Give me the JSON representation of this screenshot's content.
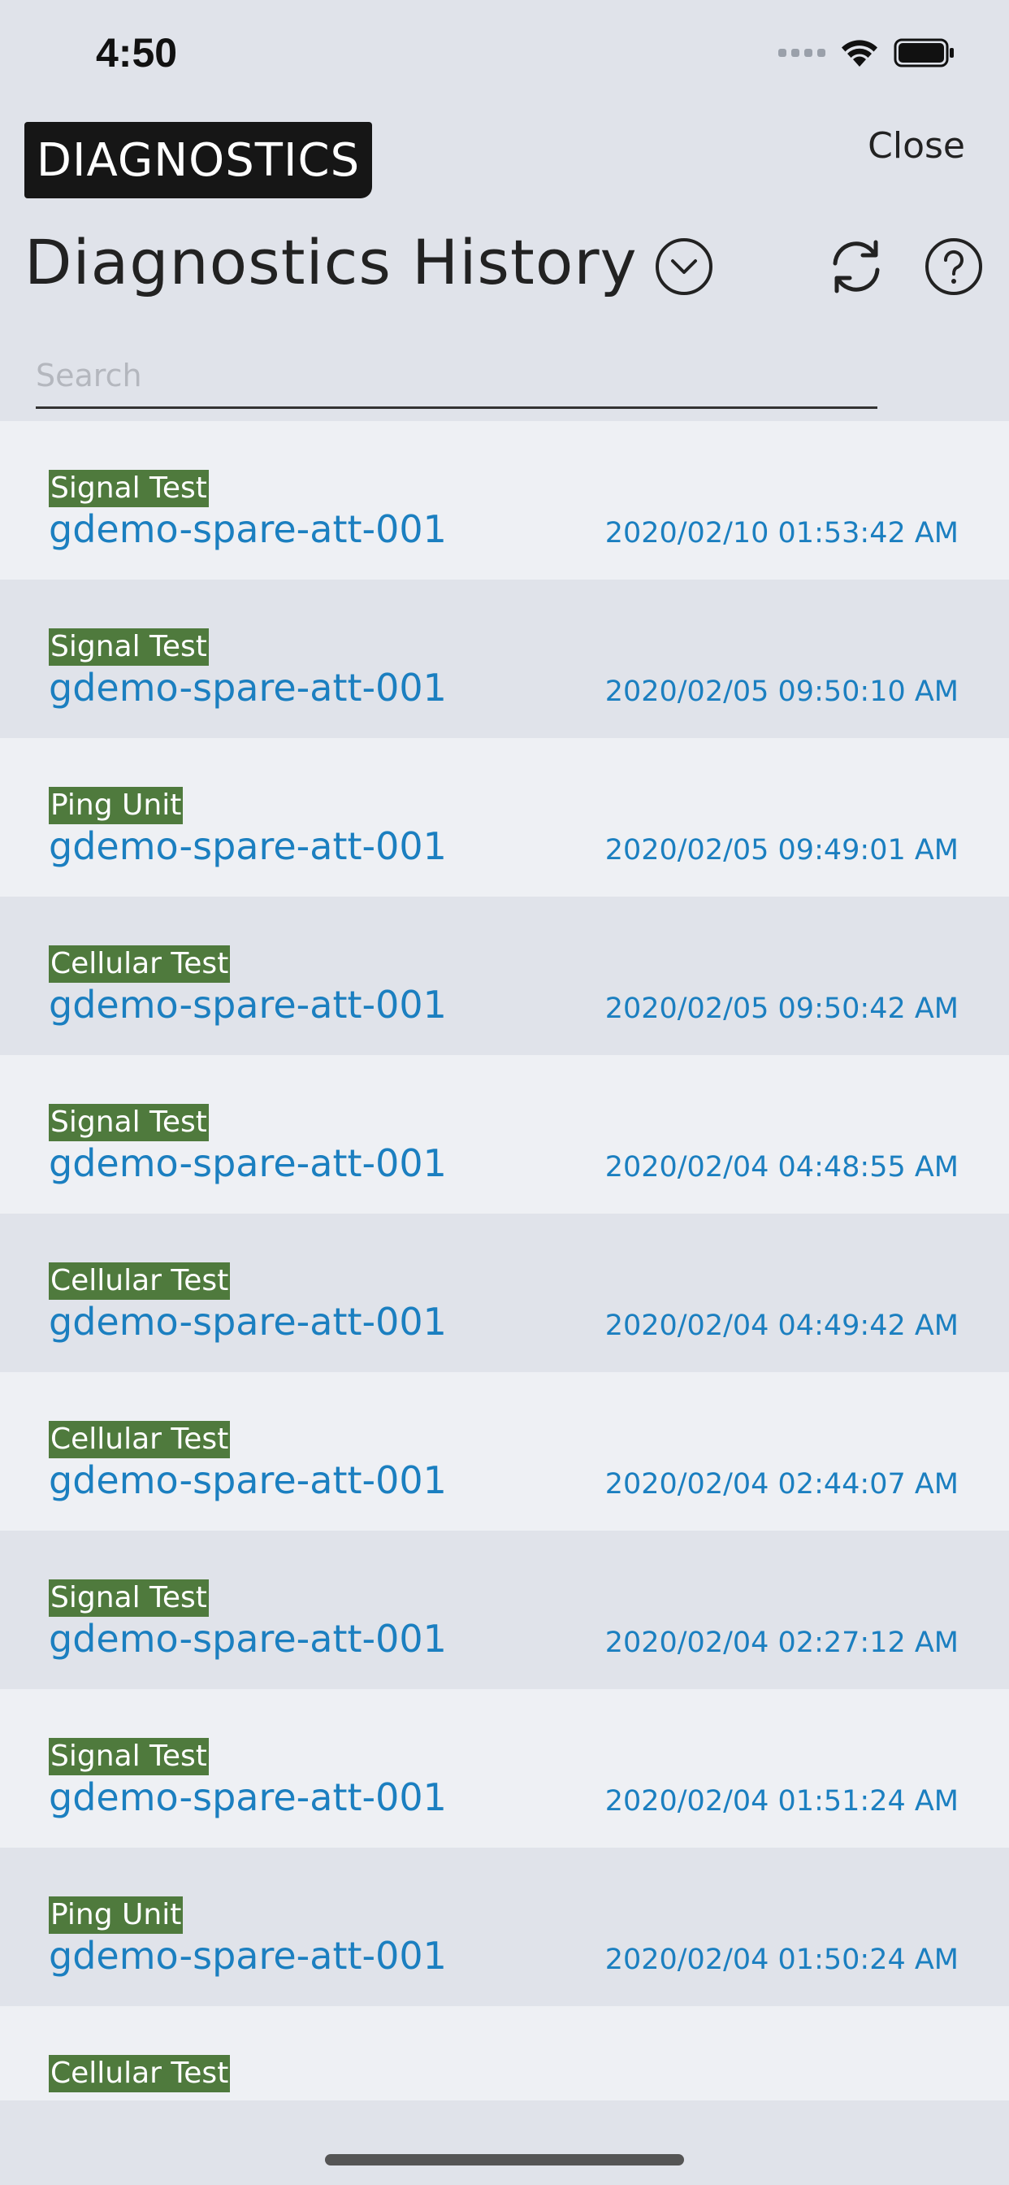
{
  "status_bar": {
    "time": "4:50",
    "icons": [
      "cellular-signal-icon",
      "wifi-icon",
      "battery-icon"
    ]
  },
  "header": {
    "brand": "DIAGNOSTICS",
    "close_label": "Close",
    "title": "Diagnostics History",
    "dropdown_icon": "chevron-down-circle-icon",
    "refresh_icon": "refresh-icon",
    "help_icon": "help-circle-icon"
  },
  "search": {
    "placeholder": "Search",
    "value": ""
  },
  "colors": {
    "tag_bg": "#4f7a3d",
    "link_text": "#1b7fc0",
    "row_light": "#eef0f4",
    "row_dark": "#e0e3ea"
  },
  "history": [
    {
      "type": "Signal Test",
      "device": "gdemo-spare-att-001",
      "timestamp": "2020/02/10 01:53:42 AM"
    },
    {
      "type": "Signal Test",
      "device": "gdemo-spare-att-001",
      "timestamp": "2020/02/05 09:50:10 AM"
    },
    {
      "type": "Ping Unit",
      "device": "gdemo-spare-att-001",
      "timestamp": "2020/02/05 09:49:01 AM"
    },
    {
      "type": "Cellular Test",
      "device": "gdemo-spare-att-001",
      "timestamp": "2020/02/05 09:50:42 AM"
    },
    {
      "type": "Signal Test",
      "device": "gdemo-spare-att-001",
      "timestamp": "2020/02/04 04:48:55 AM"
    },
    {
      "type": "Cellular Test",
      "device": "gdemo-spare-att-001",
      "timestamp": "2020/02/04 04:49:42 AM"
    },
    {
      "type": "Cellular Test",
      "device": "gdemo-spare-att-001",
      "timestamp": "2020/02/04 02:44:07 AM"
    },
    {
      "type": "Signal Test",
      "device": "gdemo-spare-att-001",
      "timestamp": "2020/02/04 02:27:12 AM"
    },
    {
      "type": "Signal Test",
      "device": "gdemo-spare-att-001",
      "timestamp": "2020/02/04 01:51:24 AM"
    },
    {
      "type": "Ping Unit",
      "device": "gdemo-spare-att-001",
      "timestamp": "2020/02/04 01:50:24 AM"
    },
    {
      "type": "Cellular Test"
    }
  ]
}
